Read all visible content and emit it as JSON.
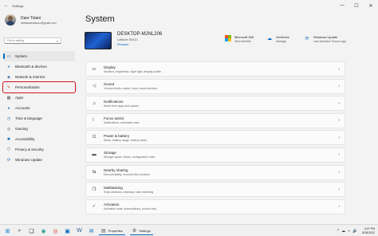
{
  "window": {
    "title": "Settings",
    "controls": [
      "—",
      "☐",
      "✕"
    ]
  },
  "profile": {
    "name": "Dare Tolani",
    "email": "akinaladealacco@gmail.com"
  },
  "search": {
    "placeholder": "Find a setting"
  },
  "nav": [
    {
      "label": "System",
      "icon": "monitor-icon",
      "glyph": "▭",
      "color": "#0067c0",
      "selected": true
    },
    {
      "label": "Bluetooth & devices",
      "icon": "bluetooth-icon",
      "glyph": "⚹",
      "color": "#0067c0"
    },
    {
      "label": "Network & internet",
      "icon": "wifi-icon",
      "glyph": "◆",
      "color": "#5b7fb3"
    },
    {
      "label": "Personalization",
      "icon": "brush-icon",
      "glyph": "✎",
      "color": "#c0501c",
      "highlight": true
    },
    {
      "label": "Apps",
      "icon": "apps-icon",
      "glyph": "▦",
      "color": "#555"
    },
    {
      "label": "Accounts",
      "icon": "person-icon",
      "glyph": "●",
      "color": "#2e8bd6"
    },
    {
      "label": "Time & language",
      "icon": "globe-clock-icon",
      "glyph": "◷",
      "color": "#0067c0"
    },
    {
      "label": "Gaming",
      "icon": "controller-icon",
      "glyph": "◎",
      "color": "#666"
    },
    {
      "label": "Accessibility",
      "icon": "accessibility-icon",
      "glyph": "✱",
      "color": "#0067c0"
    },
    {
      "label": "Privacy & security",
      "icon": "shield-icon",
      "glyph": "⛉",
      "color": "#666"
    },
    {
      "label": "Windows Update",
      "icon": "sync-icon",
      "glyph": "⟳",
      "color": "#0067c0"
    }
  ],
  "page": {
    "title": "System"
  },
  "device": {
    "name": "DESKTOP-MJNL206",
    "model": "Latitude E5410",
    "rename": "Rename"
  },
  "status": [
    {
      "title": "Microsoft 365",
      "sub": "View benefits",
      "icon": "microsoft-logo-icon"
    },
    {
      "title": "OneDrive",
      "sub": "Manage",
      "icon": "cloud-icon",
      "glyph": "☁"
    },
    {
      "title": "Windows Update",
      "sub": "Last checked: 5 hours ago",
      "icon": "update-icon",
      "glyph": "⟳"
    }
  ],
  "ms_colors": [
    "#f25022",
    "#7fba00",
    "#00a4ef",
    "#ffb900"
  ],
  "cards": [
    {
      "title": "Display",
      "sub": "Monitors, brightness, night light, display profile",
      "icon": "display-icon",
      "glyph": "▭"
    },
    {
      "title": "Sound",
      "sub": "Volume levels, output, input, sound devices",
      "icon": "speaker-icon",
      "glyph": "◁"
    },
    {
      "title": "Notifications",
      "sub": "Alerts from apps and system",
      "icon": "bell-icon",
      "glyph": "♫"
    },
    {
      "title": "Focus assist",
      "sub": "Notifications, automatic rules",
      "icon": "moon-icon",
      "glyph": "☾"
    },
    {
      "title": "Power & battery",
      "sub": "Sleep, battery usage, battery saver",
      "icon": "power-icon",
      "glyph": "⏻"
    },
    {
      "title": "Storage",
      "sub": "Storage space, drives, configuration rules",
      "icon": "storage-icon",
      "glyph": "▬"
    },
    {
      "title": "Nearby sharing",
      "sub": "Discoverability, received files location",
      "icon": "share-icon",
      "glyph": "⇆"
    },
    {
      "title": "Multitasking",
      "sub": "Snap windows, desktops, task switching",
      "icon": "multitask-icon",
      "glyph": "❐"
    },
    {
      "title": "Activation",
      "sub": "Activation state, subscriptions, product key",
      "icon": "check-icon",
      "glyph": "✓"
    }
  ],
  "chevron": "›",
  "taskbar": {
    "icons": [
      {
        "name": "start-icon",
        "glyph": "⊞",
        "color": "#0078d4"
      },
      {
        "name": "search-icon",
        "glyph": "⌕",
        "color": "#333"
      },
      {
        "name": "task-view-icon",
        "glyph": "❏",
        "color": "#333"
      },
      {
        "name": "edge-icon",
        "glyph": "◉",
        "color": "#2a9d8f"
      },
      {
        "name": "chrome-icon",
        "glyph": "◎",
        "color": "#d93025"
      },
      {
        "name": "store-icon",
        "glyph": "▣",
        "color": "#0067c0"
      },
      {
        "name": "word-icon",
        "glyph": "W",
        "color": "#2b579a"
      },
      {
        "name": "mail-icon",
        "glyph": "✉",
        "color": "#0067c0"
      }
    ],
    "apps": [
      {
        "label": "Properties",
        "icon": "properties-icon",
        "glyph": "▤"
      },
      {
        "label": "Settings",
        "icon": "settings-icon",
        "glyph": "⚙"
      }
    ],
    "tray": [
      "^",
      "☁",
      "⌁",
      "🔊"
    ],
    "time": "4:27 PM",
    "date": "8/28/2022"
  }
}
